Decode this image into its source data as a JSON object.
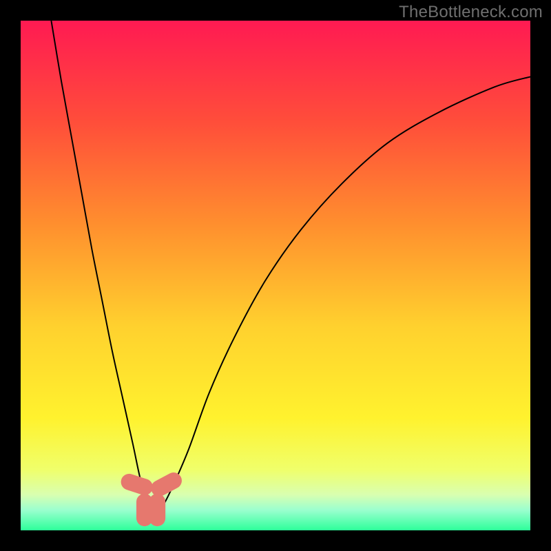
{
  "watermark": "TheBottleneck.com",
  "chart_data": {
    "type": "line",
    "title": "",
    "xlabel": "",
    "ylabel": "",
    "xlim": [
      0,
      100
    ],
    "ylim": [
      0,
      100
    ],
    "grid": false,
    "legend": false,
    "background_gradient": {
      "stops": [
        {
          "offset": 0,
          "color": "#ff1a52"
        },
        {
          "offset": 20,
          "color": "#ff4e3a"
        },
        {
          "offset": 40,
          "color": "#ff8f2e"
        },
        {
          "offset": 60,
          "color": "#ffd12e"
        },
        {
          "offset": 78,
          "color": "#fff22e"
        },
        {
          "offset": 88,
          "color": "#f0ff6a"
        },
        {
          "offset": 93,
          "color": "#d9ffb0"
        },
        {
          "offset": 96,
          "color": "#9bffcf"
        },
        {
          "offset": 100,
          "color": "#2dff9a"
        }
      ]
    },
    "series": [
      {
        "name": "bottleneck-curve",
        "x": [
          6,
          8,
          10,
          12,
          14,
          16,
          18,
          20,
          22,
          23.5,
          25,
          26.5,
          28,
          30,
          33,
          37,
          42,
          48,
          55,
          63,
          72,
          82,
          93,
          100
        ],
        "y": [
          100,
          88,
          77,
          66,
          55,
          45,
          35,
          26,
          17,
          10,
          5,
          3.5,
          5,
          9,
          16,
          27,
          38,
          49,
          59,
          68,
          76,
          82,
          87,
          89
        ],
        "color": "#000000",
        "width": 2
      }
    ],
    "markers": [
      {
        "x": 22.8,
        "y": 9.0,
        "angle": -72,
        "color": "#e6786e",
        "label": "left-upper"
      },
      {
        "x": 24.3,
        "y": 4.0,
        "angle": 0,
        "color": "#e6786e",
        "label": "bottom-left"
      },
      {
        "x": 26.8,
        "y": 4.0,
        "angle": 0,
        "color": "#e6786e",
        "label": "bottom-right"
      },
      {
        "x": 28.6,
        "y": 9.0,
        "angle": 62,
        "color": "#e6786e",
        "label": "right-upper"
      }
    ]
  }
}
